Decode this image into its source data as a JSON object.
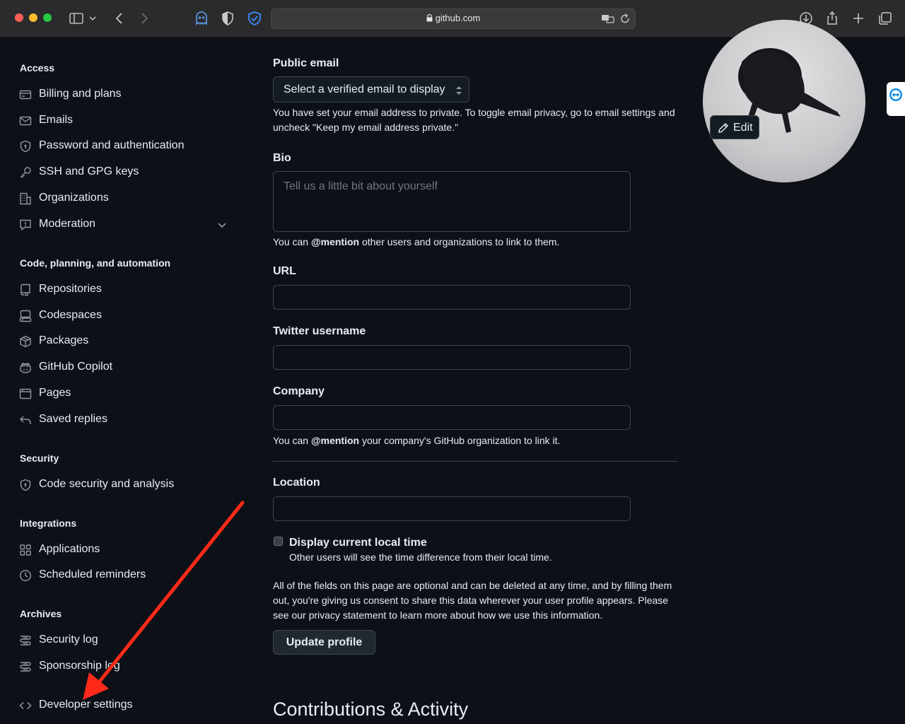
{
  "browser": {
    "url": "github.com",
    "icons": [
      "sidebar-icon",
      "chevron-down-icon",
      "back-icon",
      "forward-icon",
      "ghost-extension-icon",
      "privacy-shield-icon",
      "adguard-icon",
      "translate-icon",
      "reload-icon",
      "download-icon",
      "share-icon",
      "new-tab-icon",
      "tabs-overview-icon"
    ]
  },
  "sidebar": {
    "sections": [
      {
        "title": "Access",
        "items": [
          "Billing and plans",
          "Emails",
          "Password and authentication",
          "SSH and GPG keys",
          "Organizations",
          "Moderation"
        ]
      },
      {
        "title": "Code, planning, and automation",
        "items": [
          "Repositories",
          "Codespaces",
          "Packages",
          "GitHub Copilot",
          "Pages",
          "Saved replies"
        ]
      },
      {
        "title": "Security",
        "items": [
          "Code security and analysis"
        ]
      },
      {
        "title": "Integrations",
        "items": [
          "Applications",
          "Scheduled reminders"
        ]
      },
      {
        "title": "Archives",
        "items": [
          "Security log",
          "Sponsorship log"
        ]
      }
    ],
    "developer_settings": "Developer settings"
  },
  "profile": {
    "public_email": {
      "label": "Public email",
      "selected": "Select a verified email to display",
      "note": "You have set your email address to private. To toggle email privacy, go to email settings and uncheck \"Keep my email address private.\""
    },
    "bio": {
      "label": "Bio",
      "placeholder": "Tell us a little bit about yourself",
      "note_pre": "You can ",
      "note_mention": "@mention",
      "note_post": " other users and organizations to link to them."
    },
    "url": {
      "label": "URL",
      "value": ""
    },
    "twitter": {
      "label": "Twitter username",
      "value": ""
    },
    "company": {
      "label": "Company",
      "value": "",
      "note_pre": "You can ",
      "note_mention": "@mention",
      "note_post": " your company's GitHub organization to link it."
    },
    "location": {
      "label": "Location",
      "value": ""
    },
    "local_time": {
      "label": "Display current local time",
      "note": "Other users will see the time difference from their local time.",
      "checked": false
    },
    "consent": "All of the fields on this page are optional and can be deleted at any time, and by filling them out, you're giving us consent to share this data wherever your user profile appears. Please see our privacy statement to learn more about how we use this information.",
    "update_button": "Update profile",
    "next_heading": "Contributions & Activity"
  },
  "avatar": {
    "edit_label": "Edit"
  },
  "annotation": {
    "color": "#ff2a1a",
    "points_to": "Developer settings"
  }
}
